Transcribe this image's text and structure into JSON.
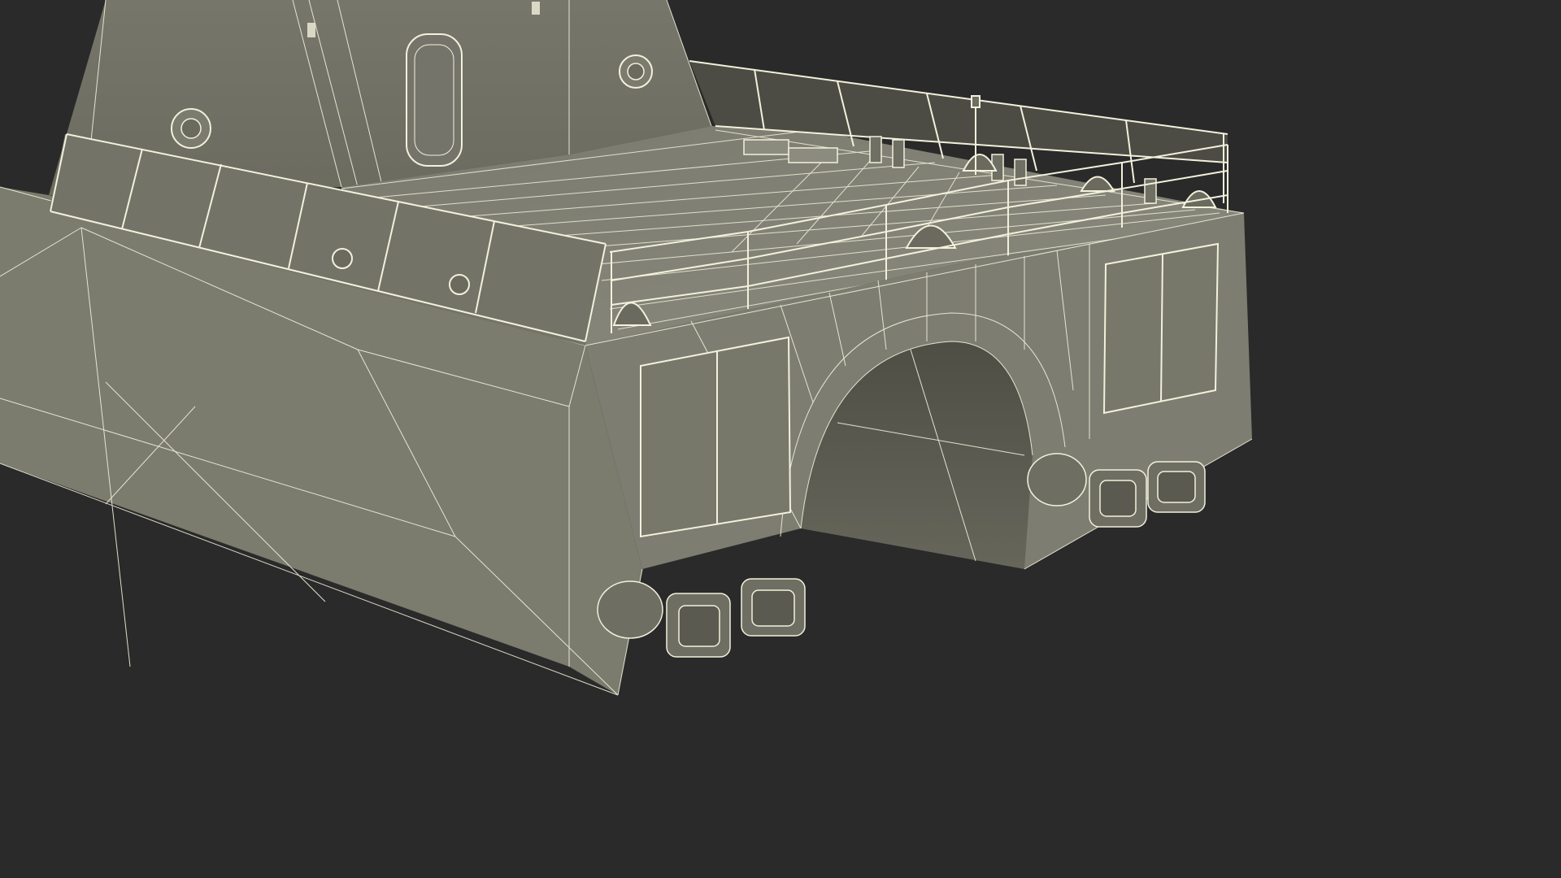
{
  "scene": {
    "subject": "catamaran-vessel-stern-wireframe",
    "colors": {
      "background": "#2a2a2a",
      "hull": "#7b7b6e",
      "hull_dark": "#6a6a5e",
      "hull_shadow": "#5d5d52",
      "deck": "#85857a",
      "wire": "#f2f1dc",
      "panel": "#77776a"
    }
  }
}
